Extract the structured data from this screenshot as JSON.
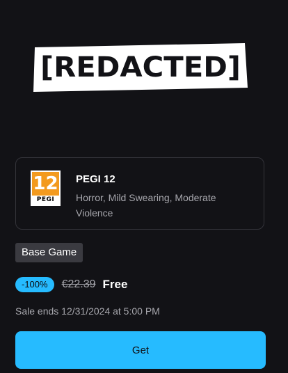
{
  "game": {
    "logo_text": "[REDACTED]"
  },
  "rating": {
    "badge_number": "12",
    "badge_label": "PEGI",
    "title": "PEGI 12",
    "descriptors": "Horror, Mild Swearing, Moderate Violence"
  },
  "offer": {
    "edition_tag": "Base Game",
    "discount": "-100%",
    "original_price": "€22.39",
    "final_price": "Free",
    "sale_ends": "Sale ends 12/31/2024 at 5:00 PM",
    "cta_label": "Get"
  },
  "colors": {
    "background": "#121216",
    "accent": "#26bbff",
    "pegi_orange": "#f39a1e",
    "tag_background": "#3a3a40",
    "muted_text": "#a7a7ad"
  }
}
